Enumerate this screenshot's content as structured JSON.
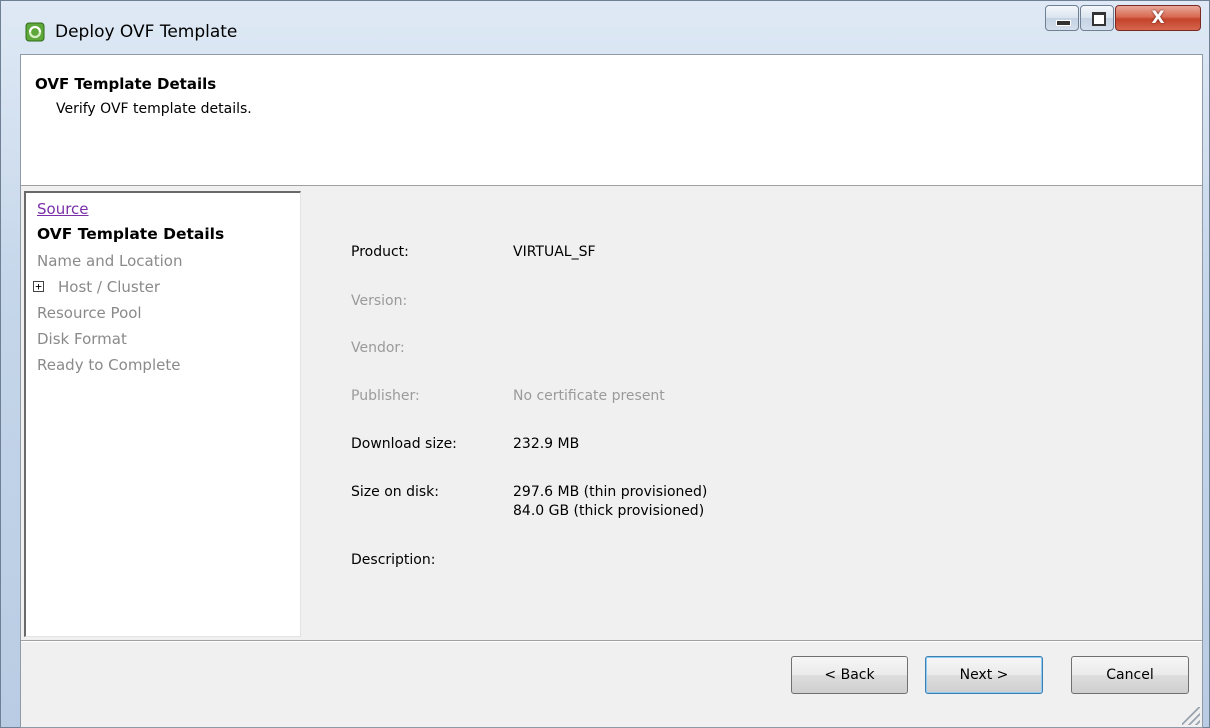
{
  "window": {
    "title": "Deploy OVF Template",
    "close_glyph": "X",
    "accent_colors": {
      "titlebar": "#c5d6ea",
      "close": "#c4432b",
      "visited_link": "#7b2fa8"
    }
  },
  "header": {
    "title": "OVF Template Details",
    "subtitle": "Verify OVF template details."
  },
  "nav": {
    "items": [
      {
        "label": "Source",
        "state": "visited-link"
      },
      {
        "label": "OVF Template Details",
        "state": "current"
      },
      {
        "label": "Name and Location",
        "state": "disabled"
      },
      {
        "label": "Host / Cluster",
        "state": "disabled",
        "expander": "+"
      },
      {
        "label": "Resource Pool",
        "state": "disabled"
      },
      {
        "label": "Disk Format",
        "state": "disabled"
      },
      {
        "label": "Ready to Complete",
        "state": "disabled"
      }
    ]
  },
  "details": {
    "product": {
      "label": "Product:",
      "value": "VIRTUAL_SF"
    },
    "version": {
      "label": "Version:",
      "value": ""
    },
    "vendor": {
      "label": "Vendor:",
      "value": ""
    },
    "publisher": {
      "label": "Publisher:",
      "value": "No certificate present"
    },
    "download_size": {
      "label": "Download size:",
      "value": "232.9 MB"
    },
    "size_on_disk": {
      "label": "Size on disk:",
      "value_thin": "297.6 MB (thin provisioned)",
      "value_thick": "84.0 GB (thick provisioned)"
    },
    "description": {
      "label": "Description:",
      "value": ""
    }
  },
  "buttons": {
    "back": "< Back",
    "next": "Next >",
    "cancel": "Cancel"
  }
}
